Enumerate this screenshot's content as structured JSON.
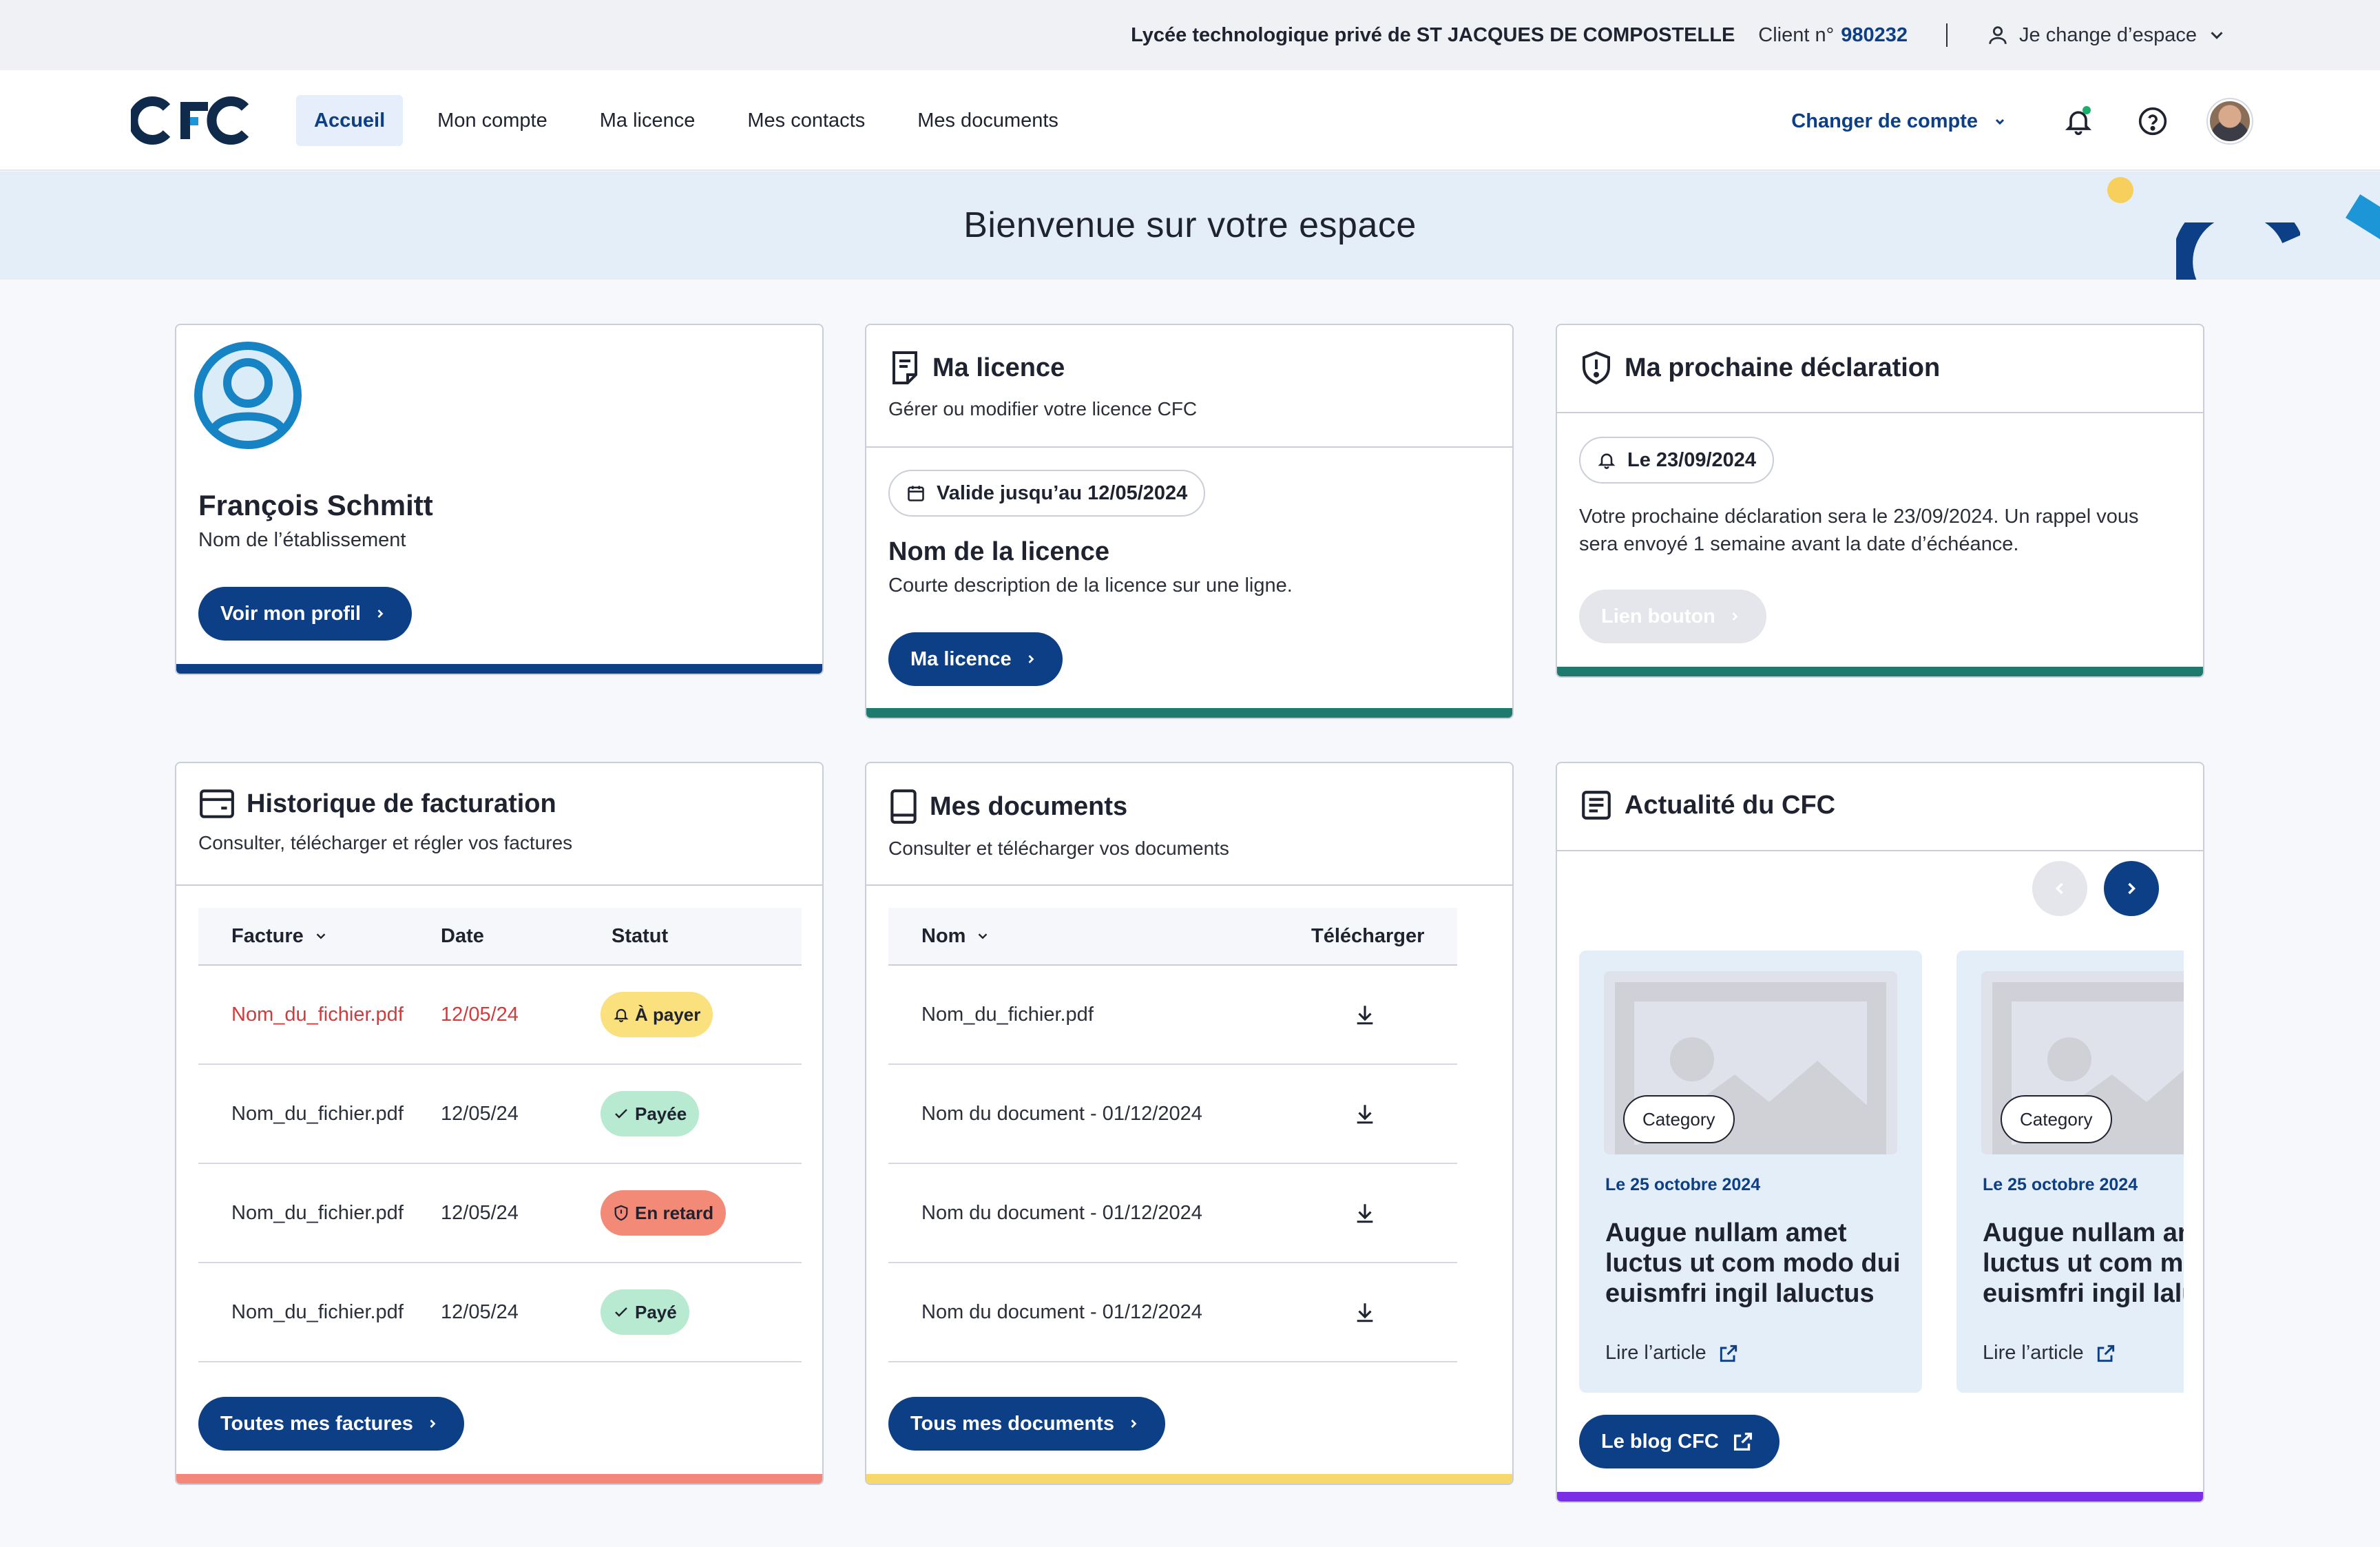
{
  "topbar": {
    "organization": "Lycée technologique privé de ST JACQUES DE COMPOSTELLE",
    "client_label": "Client n°",
    "client_number": "980232",
    "switch_space": "Je change d’espace"
  },
  "nav": {
    "logo_text": "CFC",
    "items": [
      "Accueil",
      "Mon compte",
      "Ma licence",
      "Mes contacts",
      "Mes documents"
    ],
    "change_account": "Changer de compte"
  },
  "banner": {
    "title": "Bienvenue sur votre espace"
  },
  "profile": {
    "name": "François Schmitt",
    "subtitle": "Nom de l’établissement",
    "button": "Voir mon profil"
  },
  "licence": {
    "title": "Ma licence",
    "subtitle": "Gérer ou modifier votre licence CFC",
    "validity": "Valide jusqu’au 12/05/2024",
    "name": "Nom de la licence",
    "description": "Courte description de la licence sur une ligne.",
    "button": "Ma licence"
  },
  "declaration": {
    "title": "Ma prochaine déclaration",
    "date_chip": "Le 23/09/2024",
    "text_line1": "Votre prochaine déclaration sera le 23/09/2024. Un rappel vous",
    "text_line2": "sera envoyé 1 semaine avant la date d’échéance.",
    "button": "Lien bouton"
  },
  "billing": {
    "title": "Historique de facturation",
    "subtitle": "Consulter, télécharger et régler vos factures",
    "columns": [
      "Facture",
      "Date",
      "Statut"
    ],
    "rows": [
      {
        "file": "Nom_du_fichier.pdf",
        "date": "12/05/24",
        "status": "À payer"
      },
      {
        "file": "Nom_du_fichier.pdf",
        "date": "12/05/24",
        "status": "Payée"
      },
      {
        "file": "Nom_du_fichier.pdf",
        "date": "12/05/24",
        "status": "En retard"
      },
      {
        "file": "Nom_du_fichier.pdf",
        "date": "12/05/24",
        "status": "Payé"
      }
    ],
    "button": "Toutes mes factures",
    "colors": {
      "to_pay": "#fbe07e",
      "paid": "#b7ead0",
      "late": "#f38a78",
      "alert_text": "#d23b3b"
    }
  },
  "documents": {
    "title": "Mes documents",
    "subtitle": "Consulter et télécharger vos documents",
    "columns": [
      "Nom",
      "Télécharger"
    ],
    "rows": [
      {
        "name": "Nom_du_fichier.pdf"
      },
      {
        "name": "Nom du document - 01/12/2024"
      },
      {
        "name": "Nom du document - 01/12/2024"
      },
      {
        "name": "Nom du document - 01/12/2024"
      }
    ],
    "button": "Tous mes documents"
  },
  "news": {
    "title": "Actualité du CFC",
    "articles": [
      {
        "category": "Category",
        "date": "Le 25 octobre 2024",
        "title": "Augue nullam amet luctus ut com modo dui euismfri ingil laluctus",
        "link": "Lire l’article"
      },
      {
        "category": "Category",
        "date": "Le 25 octobre 2024",
        "title": "Augue nullam amet luctus ut com modo dui euismfri ingil laluctus",
        "link": "Lire l’article"
      }
    ],
    "blog_button": "Le blog CFC"
  },
  "colors": {
    "primary": "#0d3f86",
    "card_bar_profile": "#0d3f86",
    "card_bar_teal": "#1f7a6e",
    "card_bar_billing": "#f3887a",
    "card_bar_documents": "#f7d96b",
    "card_bar_news": "#7a2ee6"
  },
  "icons": [
    "user-icon",
    "chevron-down-icon",
    "bell-icon",
    "help-icon",
    "chevron-right-icon",
    "document-icon",
    "shield-alert-icon",
    "calendar-icon",
    "wallet-icon",
    "book-icon",
    "news-icon",
    "download-icon",
    "external-link-icon",
    "check-icon"
  ]
}
